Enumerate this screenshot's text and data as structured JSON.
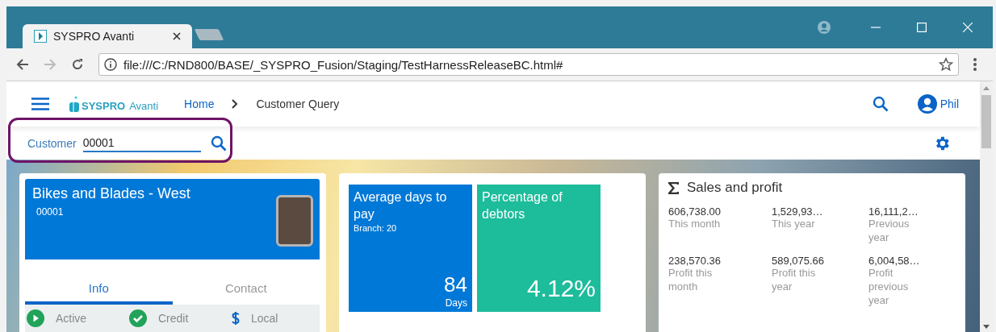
{
  "browser": {
    "tab_title": "SYSPRO Avanti",
    "url": "file:///C:/RND800/BASE/_SYSPRO_Fusion/Staging/TestHarnessReleaseBC.html#"
  },
  "header": {
    "logo_text": "SYSPRO",
    "logo_text_2": "Avanti",
    "user": "Phil",
    "breadcrumbs": [
      {
        "label": "Home",
        "link": true
      },
      {
        "label": "Customer Query",
        "link": false
      }
    ]
  },
  "customer_search": {
    "label": "Customer",
    "value": "00001"
  },
  "customer_card": {
    "name": "Bikes and Blades - West",
    "code": "00001",
    "tabs": [
      {
        "label": "Info",
        "selected": true
      },
      {
        "label": "Contact",
        "selected": false
      }
    ],
    "statuses": [
      {
        "label": "Active",
        "kind": "play"
      },
      {
        "label": "Credit",
        "kind": "check"
      },
      {
        "label": "Local",
        "kind": "currency"
      }
    ]
  },
  "tiles": [
    {
      "title": "Average days to pay",
      "subtitle": "Branch: 20",
      "value": "84",
      "unit": "Days",
      "color": "#0078d7"
    },
    {
      "title": "Percentage of debtors",
      "value": "4.12%",
      "color": "#1dbc9b"
    }
  ],
  "sales": {
    "title": "Sales and profit",
    "metrics": [
      {
        "value": "606,738.00",
        "label": "This month"
      },
      {
        "value": "1,529,93…",
        "label": "This year"
      },
      {
        "value": "16,111,2…",
        "label": "Previous year"
      },
      {
        "value": "238,570.36",
        "label": "Profit this month"
      },
      {
        "value": "589,075.66",
        "label": "Profit this year"
      },
      {
        "value": "6,004,58…",
        "label": "Profit previous year"
      }
    ]
  }
}
